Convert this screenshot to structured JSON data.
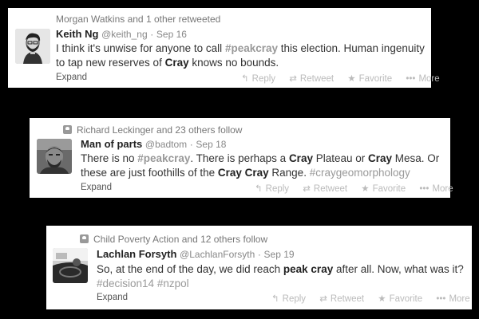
{
  "tweets": [
    {
      "context": "Morgan Watkins and 1 other retweeted",
      "name": "Keith Ng",
      "handle": "@keith_ng",
      "date": "Sep 16",
      "avatar": "cartoon-portrait",
      "text_parts": [
        {
          "t": "I think it's unwise for anyone to call ",
          "s": "n"
        },
        {
          "t": "#peakcray",
          "s": "tb"
        },
        {
          "t": " this election. Human ingenuity to tap new reserves of ",
          "s": "n"
        },
        {
          "t": "Cray",
          "s": "b"
        },
        {
          "t": " knows no bounds.",
          "s": "n"
        }
      ]
    },
    {
      "context": "Richard Leckinger and 23 others follow",
      "name": "Man of parts",
      "handle": "@badtom",
      "date": "Sep 18",
      "avatar": "photo-man",
      "text_parts": [
        {
          "t": "There is no ",
          "s": "n"
        },
        {
          "t": "#peakcray",
          "s": "tb"
        },
        {
          "t": ". There is perhaps a ",
          "s": "n"
        },
        {
          "t": "Cray",
          "s": "b"
        },
        {
          "t": " Plateau or ",
          "s": "n"
        },
        {
          "t": "Cray",
          "s": "b"
        },
        {
          "t": " Mesa. Or these are just foothills of the ",
          "s": "n"
        },
        {
          "t": "Cray Cray",
          "s": "b"
        },
        {
          "t": " Range. ",
          "s": "n"
        },
        {
          "t": "#craygeomorphology",
          "s": "t"
        }
      ]
    },
    {
      "context": "Child Poverty Action and 12 others follow",
      "name": "Lachlan Forsyth",
      "handle": "@LachlanForsyth",
      "date": "Sep 19",
      "avatar": "photo-driving",
      "text_parts": [
        {
          "t": "So, at the end of the day, we did reach ",
          "s": "n"
        },
        {
          "t": "peak cray",
          "s": "b"
        },
        {
          "t": " after all. Now, what was it?",
          "s": "n"
        },
        {
          "t": "\n",
          "s": "br"
        },
        {
          "t": "#decision14",
          "s": "t"
        },
        {
          "t": " ",
          "s": "n"
        },
        {
          "t": "#nzpol",
          "s": "t"
        }
      ]
    }
  ],
  "labels": {
    "expand": "Expand",
    "reply": "Reply",
    "retweet": "Retweet",
    "favorite": "Favorite",
    "more": "More",
    "separator": "·"
  },
  "icons": {
    "reply": "reply-icon",
    "retweet": "retweet-icon",
    "favorite": "star-icon",
    "more": "more-dots-icon",
    "context": "person-icon"
  }
}
